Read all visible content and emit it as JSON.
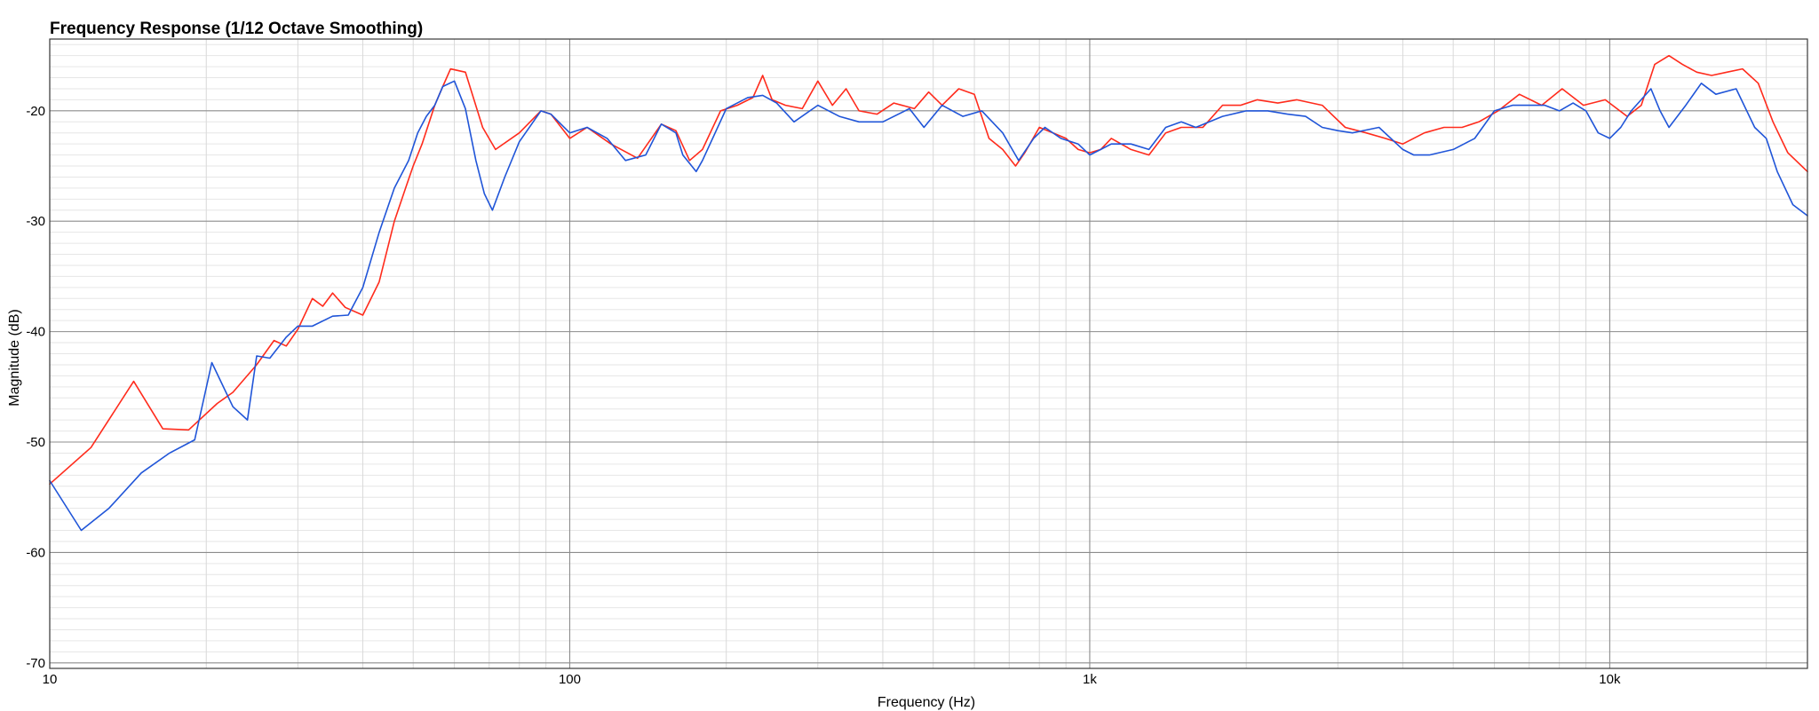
{
  "chart_data": {
    "type": "line",
    "title": "Frequency Response (1/12 Octave Smoothing)",
    "xlabel": "Frequency (Hz)",
    "ylabel": "Magnitude (dB)",
    "x_scale": "log",
    "xlim": [
      10,
      24000
    ],
    "ylim": [
      -70.5,
      -13.5
    ],
    "x_ticks": [
      10,
      100,
      1000,
      10000
    ],
    "x_tick_labels": [
      "10",
      "100",
      "1k",
      "10k"
    ],
    "y_ticks": [
      -70,
      -60,
      -50,
      -40,
      -30,
      -20
    ],
    "y_tick_labels": [
      "-70",
      "-60",
      "-50",
      "-40",
      "-30",
      "-20"
    ],
    "grid": true,
    "legend": "none",
    "series": [
      {
        "color": "#ff2b1c",
        "x": [
          10,
          12,
          14.5,
          16.5,
          18.5,
          21,
          22.5,
          25,
          27,
          28.5,
          30,
          32,
          33.5,
          35,
          37,
          40,
          43,
          46,
          48.5,
          50,
          52,
          55,
          57,
          59,
          63,
          68,
          72,
          80,
          88,
          92,
          100,
          108,
          120,
          135,
          150,
          160,
          170,
          180,
          195,
          210,
          225,
          235,
          245,
          260,
          280,
          300,
          320,
          340,
          360,
          390,
          420,
          460,
          490,
          520,
          560,
          600,
          640,
          680,
          720,
          750,
          800,
          850,
          900,
          950,
          1000,
          1050,
          1100,
          1200,
          1300,
          1400,
          1500,
          1650,
          1800,
          1950,
          2100,
          2300,
          2500,
          2800,
          3100,
          3400,
          3700,
          4000,
          4400,
          4800,
          5200,
          5600,
          6100,
          6700,
          7400,
          8100,
          8900,
          9800,
          10800,
          11500,
          12200,
          13000,
          13800,
          14700,
          15700,
          16800,
          18000,
          19300,
          20600,
          22000,
          24000
        ],
        "values": [
          -53.8,
          -50.5,
          -44.5,
          -48.8,
          -48.9,
          -46.5,
          -45.5,
          -43.0,
          -40.8,
          -41.3,
          -39.8,
          -37.0,
          -37.7,
          -36.5,
          -37.8,
          -38.5,
          -35.5,
          -30.0,
          -26.8,
          -25.0,
          -23.0,
          -19.5,
          -17.8,
          -16.2,
          -16.5,
          -21.5,
          -23.5,
          -22.0,
          -20.0,
          -20.3,
          -22.5,
          -21.5,
          -23.0,
          -24.3,
          -21.2,
          -21.8,
          -24.5,
          -23.5,
          -20.0,
          -19.5,
          -18.8,
          -16.8,
          -19.0,
          -19.5,
          -19.8,
          -17.3,
          -19.5,
          -18.0,
          -20.0,
          -20.3,
          -19.3,
          -19.8,
          -18.3,
          -19.5,
          -18.0,
          -18.5,
          -22.5,
          -23.5,
          -25.0,
          -23.8,
          -21.5,
          -22.0,
          -22.5,
          -23.5,
          -23.8,
          -23.5,
          -22.5,
          -23.5,
          -24.0,
          -22.0,
          -21.5,
          -21.5,
          -19.5,
          -19.5,
          -19.0,
          -19.3,
          -19.0,
          -19.5,
          -21.5,
          -22.0,
          -22.5,
          -23.0,
          -22.0,
          -21.5,
          -21.5,
          -21.0,
          -20.0,
          -18.5,
          -19.5,
          -18.0,
          -19.5,
          -19.0,
          -20.5,
          -19.5,
          -15.8,
          -15.0,
          -15.8,
          -16.5,
          -16.8,
          -16.5,
          -16.2,
          -17.5,
          -21.0,
          -23.8,
          -25.5
        ]
      },
      {
        "color": "#2055d8",
        "x": [
          10,
          11.5,
          13,
          15,
          17,
          19,
          20.5,
          22.5,
          24,
          25,
          26.5,
          28.5,
          30,
          32,
          35,
          37.5,
          40,
          43,
          46,
          49,
          51,
          53,
          55,
          57,
          60,
          63,
          66,
          68.5,
          71,
          75,
          80,
          88,
          92,
          100,
          108,
          118,
          128,
          140,
          150,
          160,
          165,
          175,
          180,
          200,
          220,
          235,
          250,
          270,
          300,
          330,
          360,
          400,
          450,
          480,
          520,
          570,
          620,
          680,
          730,
          780,
          820,
          880,
          950,
          1000,
          1050,
          1100,
          1200,
          1300,
          1400,
          1500,
          1600,
          1800,
          2000,
          2200,
          2400,
          2600,
          2800,
          3000,
          3200,
          3600,
          4000,
          4200,
          4500,
          5000,
          5500,
          6000,
          6500,
          7000,
          7500,
          8000,
          8500,
          9000,
          9500,
          10000,
          10500,
          11000,
          12000,
          12500,
          13000,
          14000,
          15000,
          16000,
          17500,
          19000,
          20000,
          21000,
          22500,
          24000
        ],
        "values": [
          -53.5,
          -58.0,
          -56.0,
          -52.8,
          -51.0,
          -49.8,
          -42.8,
          -46.8,
          -48.0,
          -42.2,
          -42.4,
          -40.5,
          -39.5,
          -39.5,
          -38.6,
          -38.5,
          -36.0,
          -31.0,
          -27.0,
          -24.5,
          -22.0,
          -20.5,
          -19.5,
          -17.8,
          -17.3,
          -19.8,
          -24.5,
          -27.5,
          -29.0,
          -26.0,
          -22.8,
          -20.0,
          -20.3,
          -22.0,
          -21.5,
          -22.5,
          -24.5,
          -24.0,
          -21.2,
          -22.0,
          -24.0,
          -25.5,
          -24.5,
          -19.8,
          -18.8,
          -18.6,
          -19.3,
          -21.0,
          -19.5,
          -20.5,
          -21.0,
          -21.0,
          -19.8,
          -21.5,
          -19.5,
          -20.5,
          -20.0,
          -22.0,
          -24.5,
          -22.5,
          -21.5,
          -22.5,
          -23.0,
          -24.0,
          -23.5,
          -23.0,
          -23.0,
          -23.5,
          -21.5,
          -21.0,
          -21.5,
          -20.5,
          -20.0,
          -20.0,
          -20.3,
          -20.5,
          -21.5,
          -21.8,
          -22.0,
          -21.5,
          -23.5,
          -24.0,
          -24.0,
          -23.5,
          -22.5,
          -20.0,
          -19.5,
          -19.5,
          -19.5,
          -20.0,
          -19.3,
          -20.0,
          -22.0,
          -22.5,
          -21.5,
          -20.0,
          -18.0,
          -20.0,
          -21.5,
          -19.5,
          -17.5,
          -18.5,
          -18.0,
          -21.5,
          -22.5,
          -25.5,
          -28.5,
          -29.5
        ]
      }
    ]
  }
}
